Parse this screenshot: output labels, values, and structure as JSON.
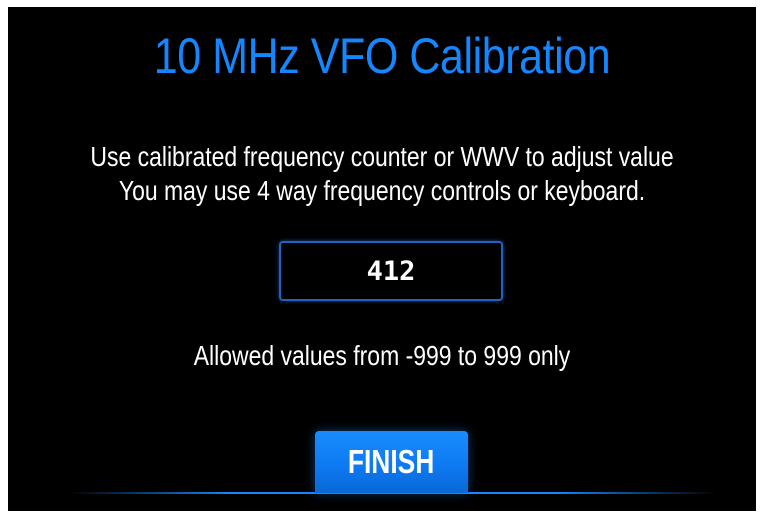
{
  "dialog": {
    "title": "10 MHz VFO Calibration",
    "instruction_line1": "Use calibrated frequency counter or WWV to adjust value",
    "instruction_line2": "You may use 4 way frequency controls or keyboard.",
    "value": "412",
    "allowed_text": "Allowed values from -999 to 999 only",
    "finish_label": "FINISH"
  },
  "colors": {
    "background": "#000000",
    "accent": "#1487ff",
    "text": "#ffffff"
  }
}
